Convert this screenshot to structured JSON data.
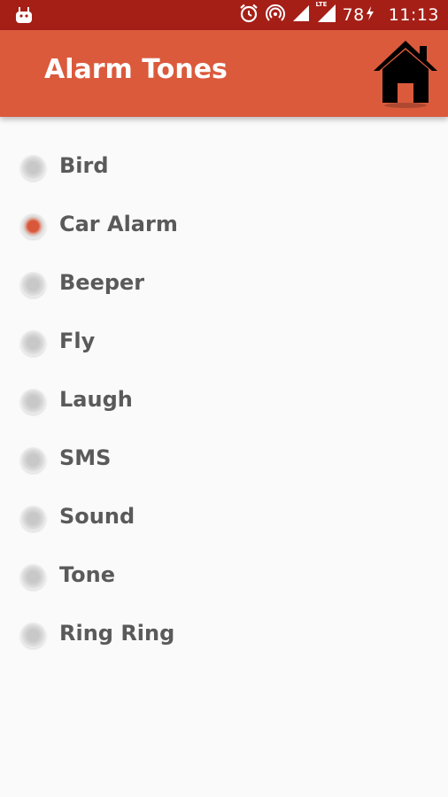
{
  "status_bar": {
    "battery": "78",
    "time": "11:13",
    "icons": [
      "android-icon",
      "alarm-icon",
      "hotspot-icon",
      "signal-icon",
      "lte-signal-icon",
      "battery-charging-icon"
    ],
    "lte_label": "LTE"
  },
  "app_bar": {
    "title": "Alarm Tones",
    "home_icon": "home-icon",
    "color": "#db5a3c"
  },
  "tones": [
    {
      "label": "Bird",
      "selected": false
    },
    {
      "label": "Car Alarm",
      "selected": true
    },
    {
      "label": "Beeper",
      "selected": false
    },
    {
      "label": "Fly",
      "selected": false
    },
    {
      "label": "Laugh",
      "selected": false
    },
    {
      "label": "SMS",
      "selected": false
    },
    {
      "label": "Sound",
      "selected": false
    },
    {
      "label": "Tone",
      "selected": false
    },
    {
      "label": "Ring Ring",
      "selected": false
    }
  ],
  "colors": {
    "status_bar": "#a51f17",
    "accent": "#d9573a",
    "text": "#5a5a5a",
    "background": "#fafafa"
  }
}
